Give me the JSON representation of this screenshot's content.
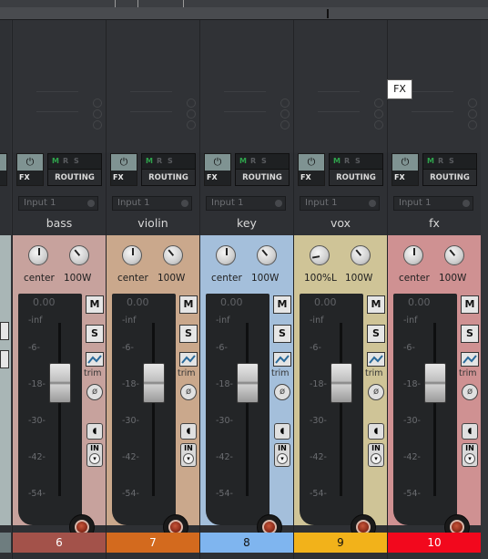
{
  "tooltip": "FX",
  "strips": [
    {
      "name": "bass",
      "number": "6",
      "input": "Input 1",
      "pan": "center",
      "width": "100W",
      "gain": "0.00",
      "body_color": "#c7a29d",
      "num_color": "#a3524a",
      "fx_label": "FX",
      "routing_label": "ROUTING",
      "m": "M",
      "r": "R",
      "s": "S",
      "mute": "M",
      "solo": "S",
      "trim": "trim",
      "in": "IN",
      "scale": [
        "-inf",
        "-6-",
        "-18-",
        "-30-",
        "-42-",
        "-54-"
      ]
    },
    {
      "name": "violin",
      "number": "7",
      "input": "Input 1",
      "pan": "center",
      "width": "100W",
      "gain": "0.00",
      "body_color": "#caa88c",
      "num_color": "#d36a1e",
      "fx_label": "FX",
      "routing_label": "ROUTING",
      "m": "M",
      "r": "R",
      "s": "S",
      "mute": "M",
      "solo": "S",
      "trim": "trim",
      "in": "IN",
      "scale": [
        "-inf",
        "-6-",
        "-18-",
        "-30-",
        "-42-",
        "-54-"
      ]
    },
    {
      "name": "key",
      "number": "8",
      "input": "Input 1",
      "pan": "center",
      "width": "100W",
      "gain": "0.00",
      "body_color": "#a4bfdb",
      "num_color": "#7fb5ef",
      "fx_label": "FX",
      "routing_label": "ROUTING",
      "m": "M",
      "r": "R",
      "s": "S",
      "mute": "M",
      "solo": "S",
      "trim": "trim",
      "in": "IN",
      "scale": [
        "-inf",
        "-6-",
        "-18-",
        "-30-",
        "-42-",
        "-54-"
      ]
    },
    {
      "name": "vox",
      "number": "9",
      "input": "Input 1",
      "pan": "100%L",
      "width": "100W",
      "gain": "0.00",
      "body_color": "#cfc497",
      "num_color": "#f2b21a",
      "fx_label": "FX",
      "routing_label": "ROUTING",
      "m": "M",
      "r": "R",
      "s": "S",
      "mute": "M",
      "solo": "S",
      "trim": "trim",
      "in": "IN",
      "scale": [
        "-inf",
        "-6-",
        "-18-",
        "-30-",
        "-42-",
        "-54-"
      ]
    },
    {
      "name": "fx",
      "number": "10",
      "input": "Input 1",
      "pan": "center",
      "width": "100W",
      "gain": "0.00",
      "body_color": "#cf9192",
      "num_color": "#f2081d",
      "fx_label": "FX",
      "routing_label": "ROUTING",
      "m": "M",
      "r": "R",
      "s": "S",
      "mute": "M",
      "solo": "S",
      "trim": "trim",
      "in": "IN",
      "scale": [
        "-inf",
        "-6-",
        "-18-",
        "-30-",
        "-42-",
        "-54-"
      ]
    }
  ]
}
